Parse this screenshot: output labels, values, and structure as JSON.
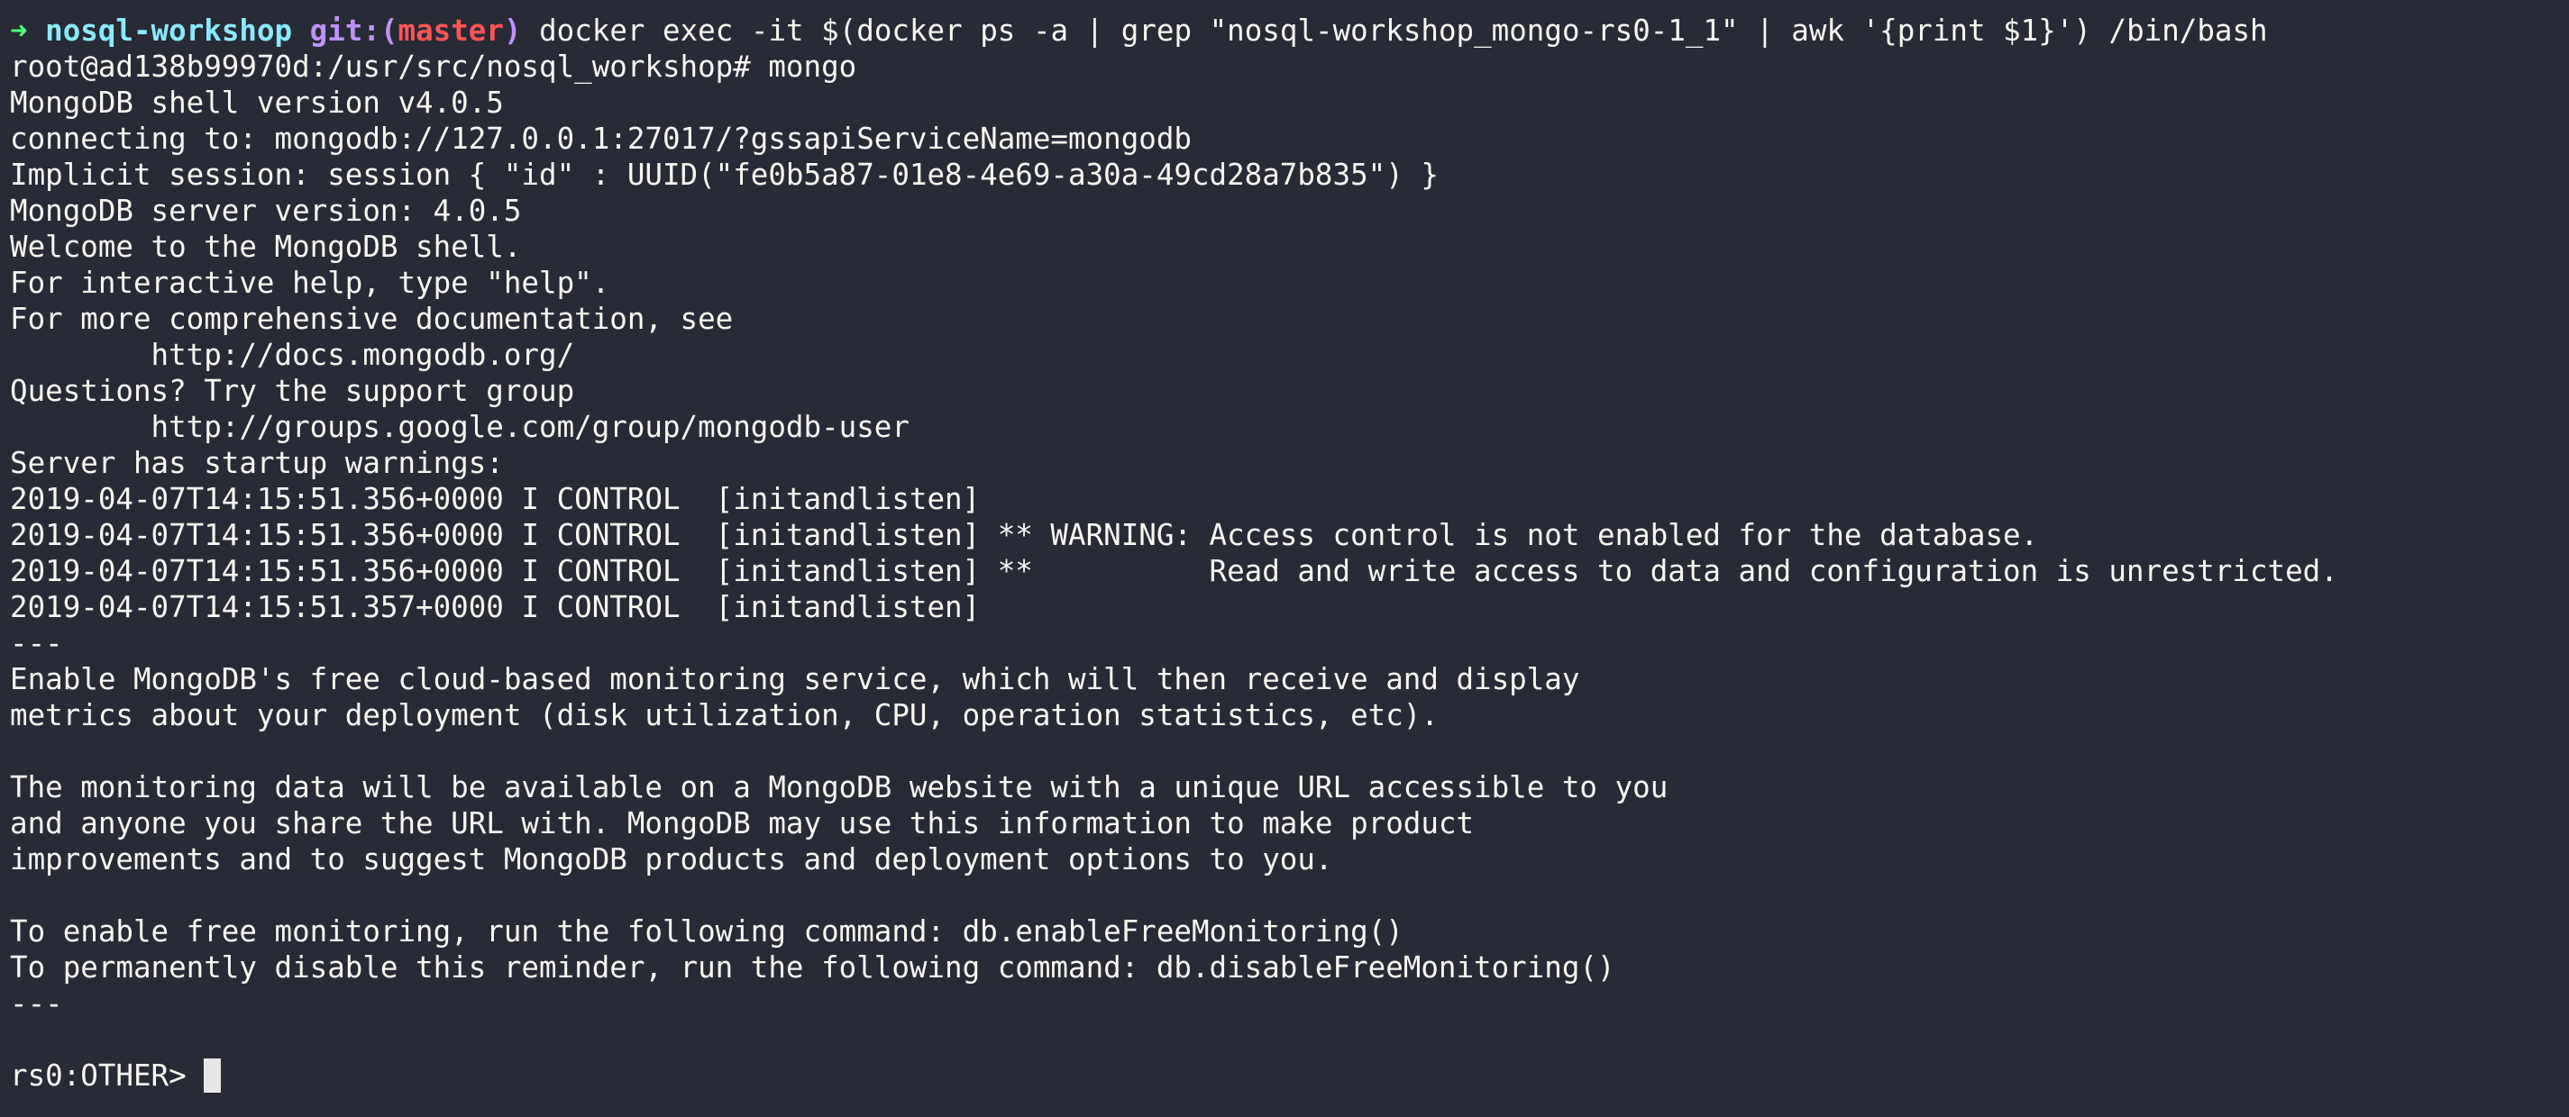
{
  "prompt": {
    "arrow": "➜",
    "directory": "nosql-workshop",
    "git_label": "git:(",
    "branch": "master",
    "git_close": ")",
    "command": "docker exec -it $(docker ps -a | grep \"nosql-workshop_mongo-rs0-1_1\" | awk '{print $1}') /bin/bash"
  },
  "colors": {
    "background": "#282a36",
    "foreground": "#f8f8f2",
    "arrow": "#50fa7b",
    "directory": "#8be9fd",
    "git": "#bd93f9",
    "branch": "#ff5555"
  },
  "output_lines": [
    "root@ad138b99970d:/usr/src/nosql_workshop# mongo",
    "MongoDB shell version v4.0.5",
    "connecting to: mongodb://127.0.0.1:27017/?gssapiServiceName=mongodb",
    "Implicit session: session { \"id\" : UUID(\"fe0b5a87-01e8-4e69-a30a-49cd28a7b835\") }",
    "MongoDB server version: 4.0.5",
    "Welcome to the MongoDB shell.",
    "For interactive help, type \"help\".",
    "For more comprehensive documentation, see",
    "        http://docs.mongodb.org/",
    "Questions? Try the support group",
    "        http://groups.google.com/group/mongodb-user",
    "Server has startup warnings:",
    "2019-04-07T14:15:51.356+0000 I CONTROL  [initandlisten]",
    "2019-04-07T14:15:51.356+0000 I CONTROL  [initandlisten] ** WARNING: Access control is not enabled for the database.",
    "2019-04-07T14:15:51.356+0000 I CONTROL  [initandlisten] **          Read and write access to data and configuration is unrestricted.",
    "2019-04-07T14:15:51.357+0000 I CONTROL  [initandlisten]",
    "---",
    "Enable MongoDB's free cloud-based monitoring service, which will then receive and display",
    "metrics about your deployment (disk utilization, CPU, operation statistics, etc).",
    "",
    "The monitoring data will be available on a MongoDB website with a unique URL accessible to you",
    "and anyone you share the URL with. MongoDB may use this information to make product",
    "improvements and to suggest MongoDB products and deployment options to you.",
    "",
    "To enable free monitoring, run the following command: db.enableFreeMonitoring()",
    "To permanently disable this reminder, run the following command: db.disableFreeMonitoring()",
    "---",
    ""
  ],
  "shell_prompt": "rs0:OTHER> "
}
